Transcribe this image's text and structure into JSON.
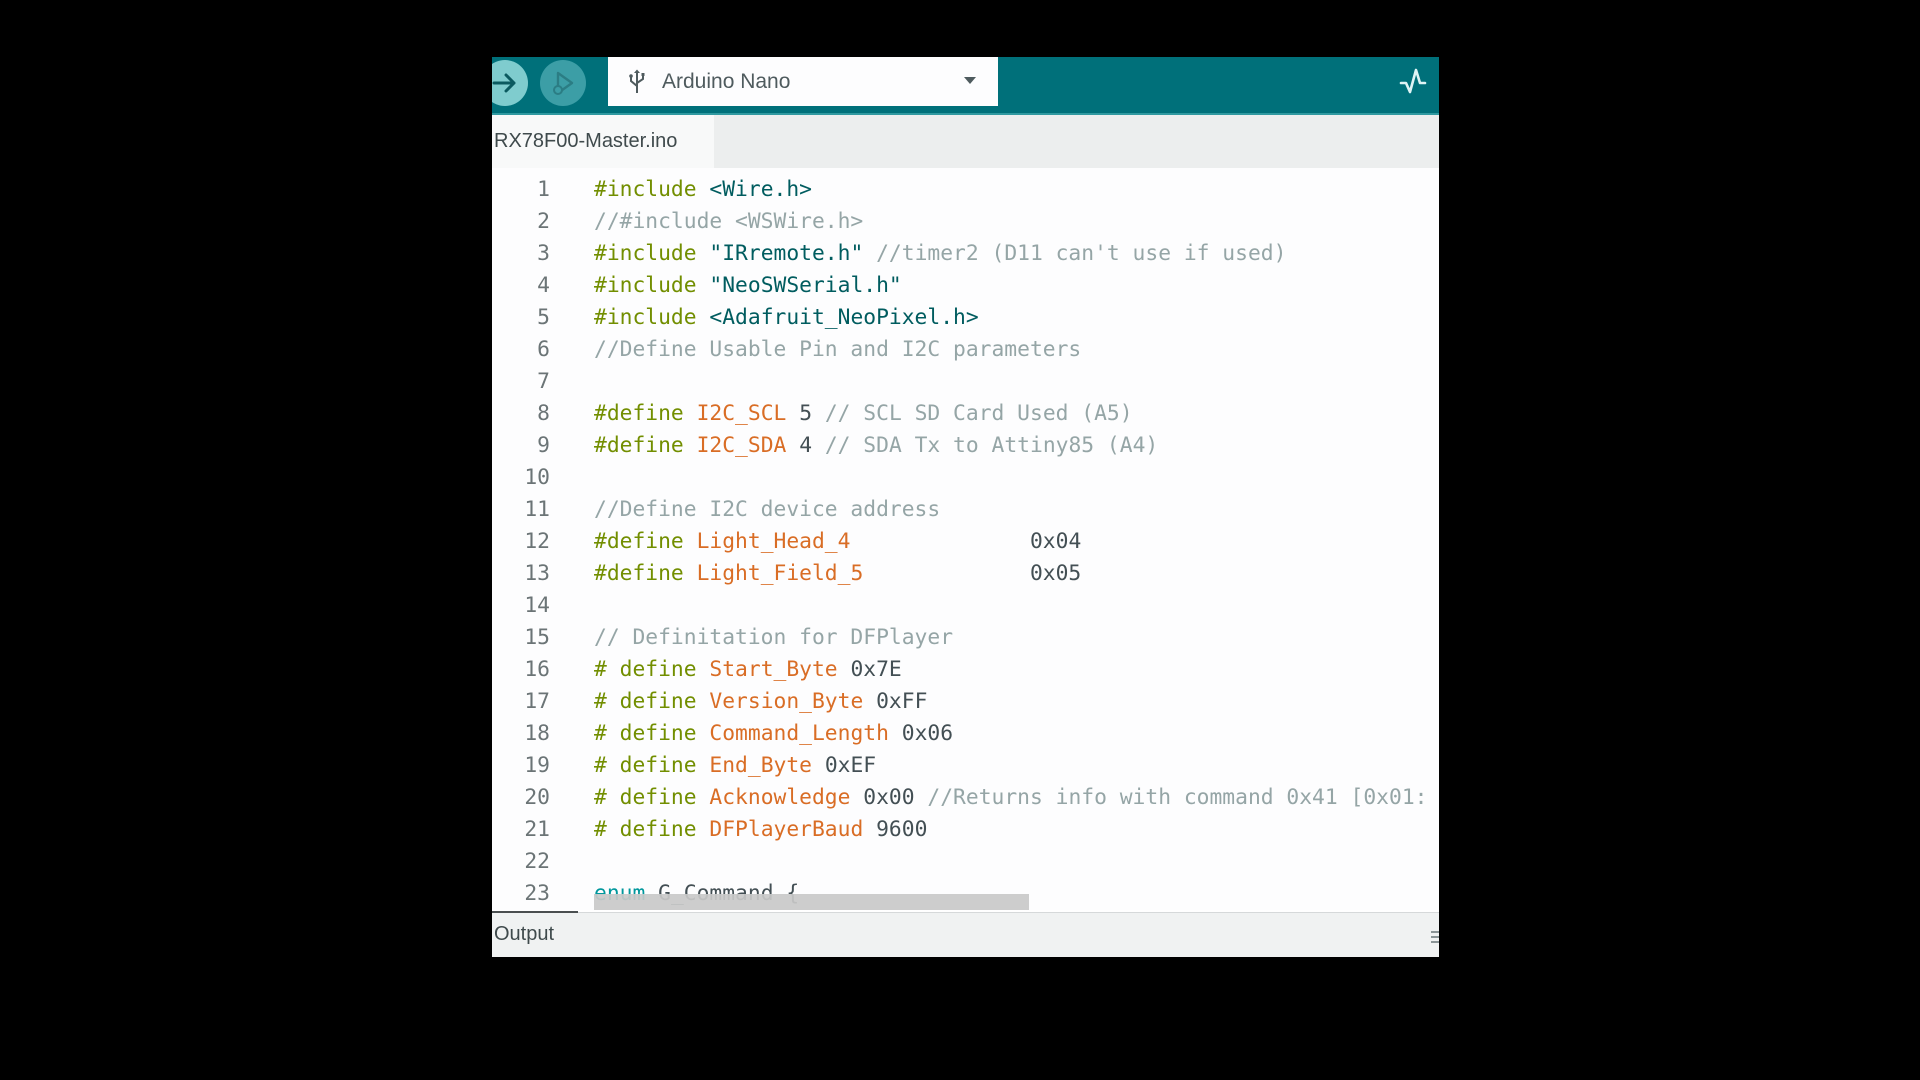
{
  "toolbar": {
    "upload_icon": "arrow-right-icon",
    "debug_icon": "debug-play-icon",
    "board_icon": "usb-icon",
    "board_name": "Arduino Nano",
    "dropdown_icon": "caret-down-icon",
    "plotter_icon": "serial-plotter-icon",
    "colors": {
      "toolbar": "#00707A",
      "upload": "#7FCCCE",
      "debug": "#3C9EA6"
    }
  },
  "tabs": [
    {
      "label": "RX78F00-Master.ino",
      "active": true
    }
  ],
  "editor": {
    "lines": [
      {
        "n": "1",
        "tokens": [
          [
            "kw",
            "#include"
          ],
          [
            "plain",
            " "
          ],
          [
            "str",
            "<Wire.h>"
          ]
        ]
      },
      {
        "n": "2",
        "tokens": [
          [
            "cm",
            "//#include <WSWire.h>"
          ]
        ]
      },
      {
        "n": "3",
        "tokens": [
          [
            "kw",
            "#include"
          ],
          [
            "plain",
            " "
          ],
          [
            "str",
            "\"IRremote.h\""
          ],
          [
            "plain",
            " "
          ],
          [
            "cm",
            "//timer2 (D11 can't use if used)"
          ]
        ]
      },
      {
        "n": "4",
        "tokens": [
          [
            "kw",
            "#include"
          ],
          [
            "plain",
            " "
          ],
          [
            "str",
            "\"NeoSWSerial.h\""
          ]
        ]
      },
      {
        "n": "5",
        "tokens": [
          [
            "kw",
            "#include"
          ],
          [
            "plain",
            " "
          ],
          [
            "str",
            "<Adafruit_NeoPixel.h>"
          ]
        ]
      },
      {
        "n": "6",
        "tokens": [
          [
            "cm",
            "//Define Usable Pin and I2C parameters"
          ]
        ]
      },
      {
        "n": "7",
        "tokens": []
      },
      {
        "n": "8",
        "tokens": [
          [
            "kw",
            "#define"
          ],
          [
            "plain",
            " "
          ],
          [
            "id",
            "I2C_SCL"
          ],
          [
            "plain",
            " "
          ],
          [
            "num",
            "5"
          ],
          [
            "plain",
            " "
          ],
          [
            "cm",
            "// SCL SD Card Used (A5)"
          ]
        ]
      },
      {
        "n": "9",
        "tokens": [
          [
            "kw",
            "#define"
          ],
          [
            "plain",
            " "
          ],
          [
            "id",
            "I2C_SDA"
          ],
          [
            "plain",
            " "
          ],
          [
            "num",
            "4"
          ],
          [
            "plain",
            " "
          ],
          [
            "cm",
            "// SDA Tx to Attiny85 (A4)"
          ]
        ]
      },
      {
        "n": "10",
        "tokens": []
      },
      {
        "n": "11",
        "tokens": [
          [
            "cm",
            "//Define I2C device address"
          ]
        ]
      },
      {
        "n": "12",
        "tokens": [
          [
            "kw",
            "#define"
          ],
          [
            "plain",
            " "
          ],
          [
            "id",
            "Light_Head_4"
          ],
          [
            "plain",
            "              "
          ],
          [
            "num",
            "0x04"
          ]
        ]
      },
      {
        "n": "13",
        "tokens": [
          [
            "kw",
            "#define"
          ],
          [
            "plain",
            " "
          ],
          [
            "id",
            "Light_Field_5"
          ],
          [
            "plain",
            "             "
          ],
          [
            "num",
            "0x05"
          ]
        ]
      },
      {
        "n": "14",
        "tokens": []
      },
      {
        "n": "15",
        "tokens": [
          [
            "cm",
            "// Definitation for DFPlayer"
          ]
        ]
      },
      {
        "n": "16",
        "tokens": [
          [
            "kw",
            "# define"
          ],
          [
            "plain",
            " "
          ],
          [
            "id",
            "Start_Byte"
          ],
          [
            "plain",
            " "
          ],
          [
            "num",
            "0x7E"
          ]
        ]
      },
      {
        "n": "17",
        "tokens": [
          [
            "kw",
            "# define"
          ],
          [
            "plain",
            " "
          ],
          [
            "id",
            "Version_Byte"
          ],
          [
            "plain",
            " "
          ],
          [
            "num",
            "0xFF"
          ]
        ]
      },
      {
        "n": "18",
        "tokens": [
          [
            "kw",
            "# define"
          ],
          [
            "plain",
            " "
          ],
          [
            "id",
            "Command_Length"
          ],
          [
            "plain",
            " "
          ],
          [
            "num",
            "0x06"
          ]
        ]
      },
      {
        "n": "19",
        "tokens": [
          [
            "kw",
            "# define"
          ],
          [
            "plain",
            " "
          ],
          [
            "id",
            "End_Byte"
          ],
          [
            "plain",
            " "
          ],
          [
            "num",
            "0xEF"
          ]
        ]
      },
      {
        "n": "20",
        "tokens": [
          [
            "kw",
            "# define"
          ],
          [
            "plain",
            " "
          ],
          [
            "id",
            "Acknowledge"
          ],
          [
            "plain",
            " "
          ],
          [
            "num",
            "0x00"
          ],
          [
            "plain",
            " "
          ],
          [
            "cm",
            "//Returns info with command 0x41 [0x01:"
          ]
        ]
      },
      {
        "n": "21",
        "tokens": [
          [
            "kw",
            "# define"
          ],
          [
            "plain",
            " "
          ],
          [
            "id",
            "DFPlayerBaud"
          ],
          [
            "plain",
            " "
          ],
          [
            "num",
            "9600"
          ]
        ]
      },
      {
        "n": "22",
        "tokens": []
      },
      {
        "n": "23",
        "tokens": [
          [
            "enum",
            "enum"
          ],
          [
            "plain",
            " G_Command {"
          ]
        ]
      }
    ],
    "syntax_colors": {
      "keyword": "#728E00",
      "identifier": "#D35400",
      "string": "#005C5F",
      "comment": "#95A5A6",
      "number": "#434F54",
      "enum": "#00979C"
    }
  },
  "output_panel": {
    "label": "Output",
    "menu_icon": "hamburger-menu-icon"
  }
}
